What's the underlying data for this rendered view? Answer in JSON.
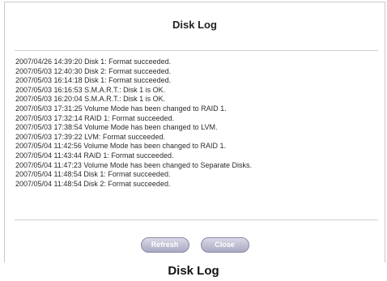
{
  "dialog": {
    "title": "Disk Log",
    "log_entries": [
      "2007/04/26 14:39:20 Disk 1: Format succeeded.",
      "2007/05/03 12:40:30 Disk 2: Format succeeded.",
      "2007/05/03 16:14:18 Disk 1: Format succeeded.",
      "2007/05/03 16:16:53 S.M.A.R.T.: Disk 1 is OK.",
      "2007/05/03 16:20:04 S.M.A.R.T.: Disk 1 is OK.",
      "2007/05/03 17:31:25 Volume Mode has been changed to RAID 1.",
      "2007/05/03 17:32:14 RAID 1: Format succeeded.",
      "2007/05/03 17:38:54 Volume Mode has been changed to LVM.",
      "2007/05/03 17:39:22 LVM: Format succeeded.",
      "2007/05/04 11:42:56 Volume Mode has been changed to RAID 1.",
      "2007/05/04 11:43:44 RAID 1: Format succeeded.",
      "2007/05/04 11:47:23 Volume Mode has been changed to Separate Disks.",
      "2007/05/04 11:48:54 Disk 1: Format succeeded.",
      "2007/05/04 11:48:54 Disk 2: Format succeeded."
    ],
    "buttons": {
      "refresh_label": "Refresh",
      "close_label": "Close"
    }
  },
  "caption": "Disk Log"
}
